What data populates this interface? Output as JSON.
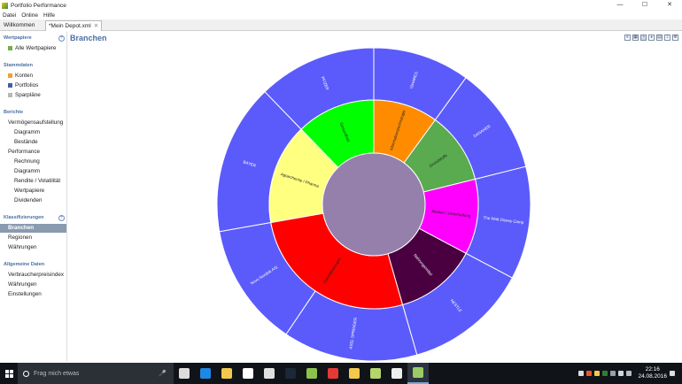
{
  "window": {
    "title": "Portfolio Performance",
    "controls": [
      "—",
      "☐",
      "✕"
    ]
  },
  "menu": [
    "Datei",
    "Online",
    "Hilfe"
  ],
  "tabs": [
    {
      "label": "Willkommen"
    },
    {
      "label": "*Mein Depot.xml",
      "close": "✕"
    }
  ],
  "sidebar": {
    "sections": [
      {
        "title": "Wertpapiere"
      },
      {
        "title": "Stammdaten"
      },
      {
        "title": "Berichte"
      },
      {
        "title": "Klassifizierungen"
      },
      {
        "title": "Allgemeine Daten"
      }
    ],
    "items": [
      {
        "label": "Alle Wertpapiere",
        "color": "#6fb048"
      },
      {
        "label": "Konten",
        "color": "#f0a030"
      },
      {
        "label": "Portfolios",
        "color": "#3a62a8"
      },
      {
        "label": "Sparpläne",
        "color": "#b8b8b8"
      },
      {
        "label": "Vermögensaufstellung"
      },
      {
        "label": "Diagramm"
      },
      {
        "label": "Bestände"
      },
      {
        "label": "Performance"
      },
      {
        "label": "Rechnung"
      },
      {
        "label": "Diagramm"
      },
      {
        "label": "Rendite / Volatilität"
      },
      {
        "label": "Wertpapiere"
      },
      {
        "label": "Dividenden"
      },
      {
        "label": "Branchen"
      },
      {
        "label": "Regionen"
      },
      {
        "label": "Währungen"
      },
      {
        "label": "Verbraucherpreisindex"
      },
      {
        "label": "Währungen"
      },
      {
        "label": "Einstellungen"
      }
    ],
    "add_symbol": "+"
  },
  "content": {
    "title": "Branchen"
  },
  "chart_data": {
    "type": "sunburst",
    "center_color": "#957fab",
    "inner_ring": [
      {
        "label": "Informationstechnologie",
        "value": 36.0,
        "color": "#ff8c00"
      },
      {
        "label": "Grundstoffe",
        "value": 40.0,
        "color": "#5aaa50"
      },
      {
        "label": "Medien / Unterhaltung",
        "value": 42.0,
        "color": "#ff00ff"
      },
      {
        "label": "Nahrungsmittel",
        "value": 46.0,
        "color": "#4a0040"
      },
      {
        "label": "Dienstleistungen",
        "value": 96.0,
        "color": "#ff0000"
      },
      {
        "label": "Agrarchemie / Pharma",
        "value": 56.0,
        "color": "#ffff80"
      },
      {
        "label": "Gesundheit",
        "value": 44.0,
        "color": "#00ff00"
      }
    ],
    "outer_ring": [
      {
        "label": "ISHARES",
        "value": 36.0,
        "color": "#5b5bfb"
      },
      {
        "label": "DANAHER",
        "value": 40.0,
        "color": "#5b5bfb"
      },
      {
        "label": "The Walt Disney Comp",
        "value": 42.0,
        "color": "#5b5bfb"
      },
      {
        "label": "NESTLE",
        "value": 46.0,
        "color": "#5b5bfb"
      },
      {
        "label": "AXEL SPRINGER",
        "value": 50.0,
        "color": "#5b5bfb"
      },
      {
        "label": "Novo Nordisk A/S",
        "value": 46.0,
        "color": "#5b5bfb"
      },
      {
        "label": "BAYER",
        "value": 56.0,
        "color": "#5b5bfb"
      },
      {
        "label": "PFIZER",
        "value": 44.0,
        "color": "#5b5bfb"
      }
    ]
  },
  "taskbar": {
    "search_placeholder": "Frag mich etwas",
    "mic": "🎤",
    "time": "22:16",
    "date": "24.08.2016",
    "apps": [
      {
        "name": "task-view",
        "color": "#dcdcdc"
      },
      {
        "name": "edge",
        "color": "#1e88e5"
      },
      {
        "name": "explorer",
        "color": "#f2c94c"
      },
      {
        "name": "store",
        "color": "#ffffff"
      },
      {
        "name": "calculator",
        "color": "#e0e0e0"
      },
      {
        "name": "steam",
        "color": "#1b2838"
      },
      {
        "name": "game",
        "color": "#8bc34a"
      },
      {
        "name": "chrome",
        "color": "#e53935"
      },
      {
        "name": "file-manager",
        "color": "#f2c94c"
      },
      {
        "name": "portfolio",
        "color": "#b5d66b"
      },
      {
        "name": "security",
        "color": "#eeeeee"
      },
      {
        "name": "portfolio-performance",
        "color": "#9ccc65"
      }
    ]
  }
}
